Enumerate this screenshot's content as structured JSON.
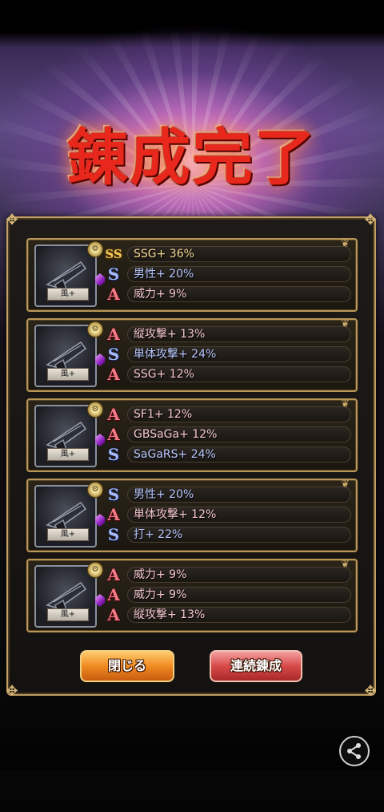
{
  "title": "錬成完了",
  "cards": [
    {
      "weapon_label": "風+",
      "stats": [
        {
          "rank": "SS",
          "text": "SSG+ 36%"
        },
        {
          "rank": "S",
          "text": "男性+ 20%"
        },
        {
          "rank": "A",
          "text": "威力+ 9%"
        }
      ]
    },
    {
      "weapon_label": "風+",
      "stats": [
        {
          "rank": "A",
          "text": "縦攻撃+ 13%"
        },
        {
          "rank": "S",
          "text": "単体攻撃+ 24%"
        },
        {
          "rank": "A",
          "text": "SSG+ 12%"
        }
      ]
    },
    {
      "weapon_label": "風+",
      "stats": [
        {
          "rank": "A",
          "text": "SF1+ 12%"
        },
        {
          "rank": "A",
          "text": "GBSaGa+ 12%"
        },
        {
          "rank": "S",
          "text": "SaGaRS+ 24%"
        }
      ]
    },
    {
      "weapon_label": "風+",
      "stats": [
        {
          "rank": "S",
          "text": "男性+ 20%"
        },
        {
          "rank": "A",
          "text": "単体攻撃+ 12%"
        },
        {
          "rank": "S",
          "text": "打+ 22%"
        }
      ]
    },
    {
      "weapon_label": "風+",
      "stats": [
        {
          "rank": "A",
          "text": "威力+ 9%"
        },
        {
          "rank": "A",
          "text": "威力+ 9%"
        },
        {
          "rank": "A",
          "text": "縦攻撃+ 13%"
        }
      ]
    }
  ],
  "buttons": {
    "close": "閉じる",
    "continue": "連続錬成"
  },
  "icons": {
    "share": "share-icon",
    "weapon": "pistol-icon",
    "gear": "gear-icon",
    "gem": "gem-icon"
  }
}
